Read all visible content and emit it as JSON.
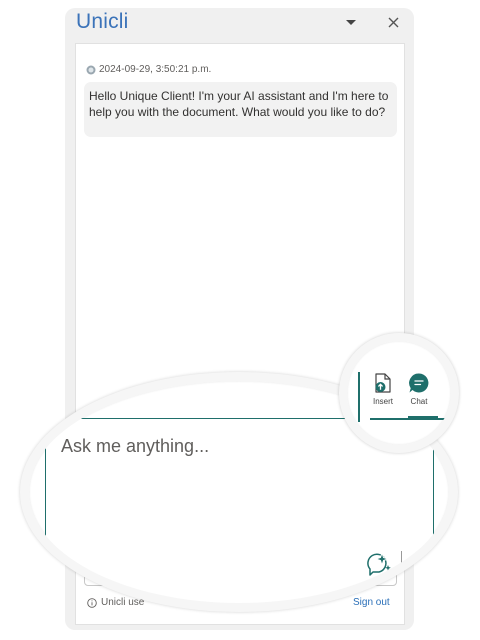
{
  "pane": {
    "title": "Unicli",
    "menu_icon": "chevron-down-icon",
    "close_icon": "close-icon"
  },
  "message": {
    "timestamp": "2024-09-29, 3:50:21 p.m.",
    "text": "Hello Unique Client! I'm your AI assistant and I'm here to help you with the document. What would you like to do?"
  },
  "footer": {
    "info_text": "Unicli use",
    "sign_out": "Sign out"
  },
  "composer": {
    "placeholder": "Ask me anything..."
  },
  "tabs": [
    {
      "label": "Insert",
      "icon": "insert-document-icon"
    },
    {
      "label": "Chat",
      "icon": "chat-icon",
      "active": true
    }
  ],
  "colors": {
    "accent": "#1f6f6b",
    "title": "#3b73b9",
    "link": "#2a6fb8"
  }
}
